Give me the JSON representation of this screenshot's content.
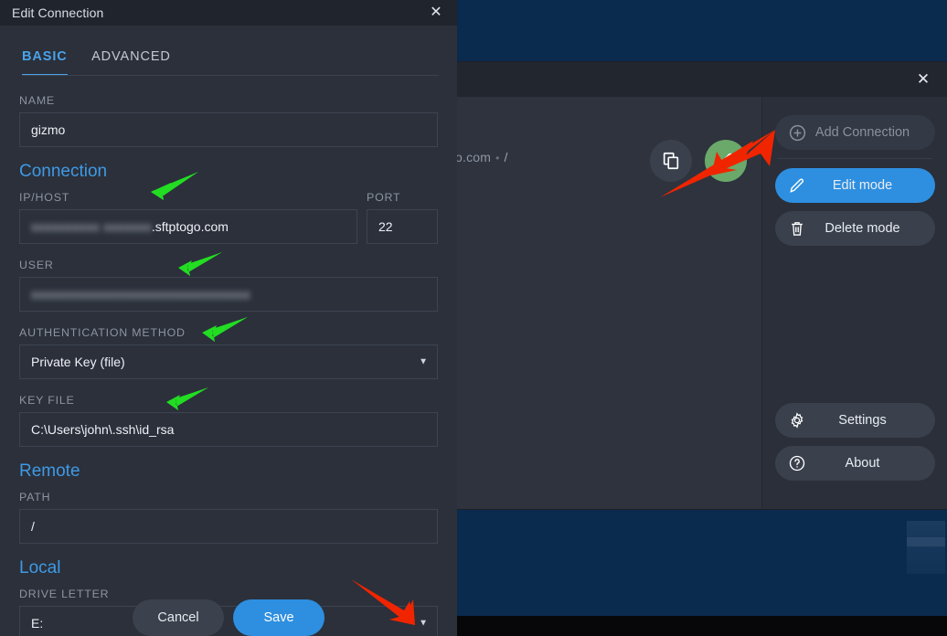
{
  "dialog": {
    "title": "Edit Connection",
    "close_icon": "close-icon",
    "tabs": [
      {
        "label": "BASIC",
        "active": true
      },
      {
        "label": "ADVANCED",
        "active": false
      }
    ],
    "fields": {
      "name_label": "NAME",
      "name_value": "gizmo",
      "connection_heading": "Connection",
      "host_label": "IP/HOST",
      "host_redacted": "xxxxxxxxxx xxxxxxx",
      "host_value": ".sftptogo.com",
      "port_label": "PORT",
      "port_value": "22",
      "user_label": "USER",
      "user_redacted": "xxxxxxxxxxxxxxxxxxxxxxxxxxxxxxxx",
      "auth_label": "AUTHENTICATION METHOD",
      "auth_value": "Private Key (file)",
      "keyfile_label": "KEY FILE",
      "keyfile_value": "C:\\Users\\john\\.ssh\\id_rsa",
      "remote_heading": "Remote",
      "path_label": "PATH",
      "path_value": "/",
      "local_heading": "Local",
      "drive_label": "DRIVE LETTER",
      "drive_value": "E:"
    },
    "footer": {
      "cancel_label": "Cancel",
      "save_label": "Save"
    }
  },
  "app_window": {
    "close_icon": "close-icon",
    "connection_text": "o.com",
    "separator": "•",
    "path_text": "/",
    "copy_icon": "copy-icon",
    "edit_icon": "pencil-icon"
  },
  "sidebar": {
    "items": [
      {
        "label": "Add Connection",
        "icon": "plus-circle-icon",
        "state": "disabled"
      },
      {
        "label": "Edit mode",
        "icon": "pencil-icon",
        "state": "primary"
      },
      {
        "label": "Delete mode",
        "icon": "trash-icon",
        "state": "normal"
      }
    ],
    "bottom_items": [
      {
        "label": "Settings",
        "icon": "gear-icon"
      },
      {
        "label": "About",
        "icon": "question-circle-icon"
      }
    ]
  },
  "annotations": {
    "green_arrows": 5,
    "red_arrows": 2,
    "green_color": "#22dd22",
    "red_color": "#f02500"
  },
  "colors": {
    "accent": "#2e8fe0",
    "heading": "#3f9ae4",
    "dialog_bg": "#2b303b",
    "titlebar_bg": "#20242c",
    "sidebar_bg": "#2a2f39",
    "edit_circle": "#6aa96a"
  }
}
